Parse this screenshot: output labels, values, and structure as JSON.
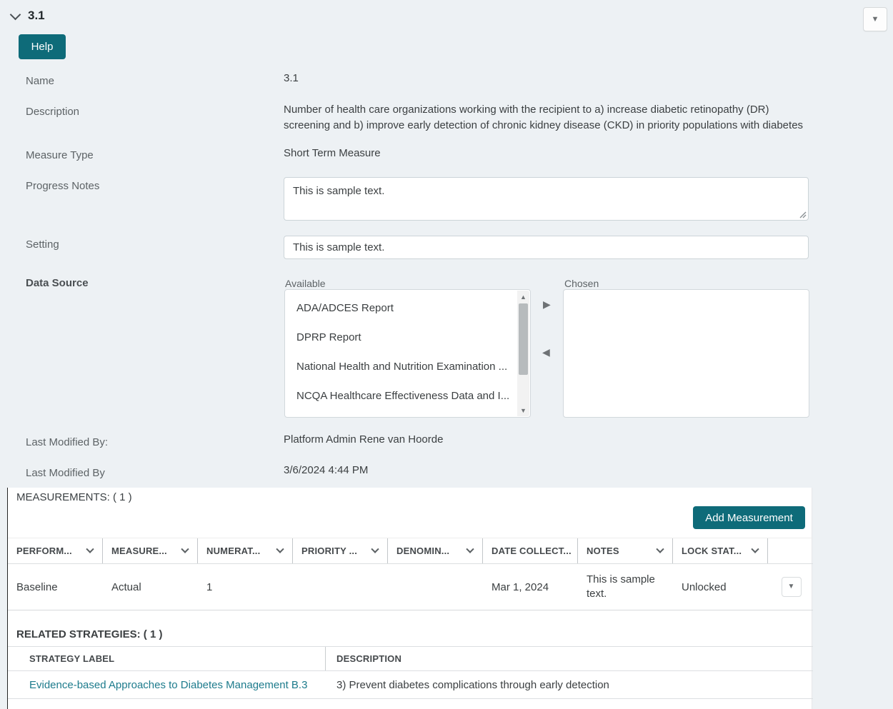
{
  "header": {
    "title": "3.1",
    "help_label": "Help"
  },
  "icons": {
    "dropdown_arrow": "▼",
    "move_right": "▶",
    "move_left": "◀",
    "scroll_up": "▲",
    "scroll_down": "▼"
  },
  "fields": {
    "name": {
      "label": "Name",
      "value": "3.1"
    },
    "description": {
      "label": "Description",
      "value": "Number of health care organizations working with the recipient to a) increase diabetic retinopathy (DR) screening and b) improve early detection of chronic kidney disease (CKD) in priority populations with diabetes"
    },
    "measure_type": {
      "label": "Measure Type",
      "value": "Short Term Measure"
    },
    "progress_notes": {
      "label": "Progress Notes",
      "value": "This is sample text."
    },
    "setting": {
      "label": "Setting",
      "value": "This is sample text."
    },
    "data_source": {
      "label": "Data Source",
      "available_label": "Available",
      "chosen_label": "Chosen",
      "available_options": [
        "ADA/ADCES Report",
        "DPRP Report",
        "National Health and Nutrition Examination ...",
        "NCQA Healthcare Effectiveness Data and I..."
      ],
      "chosen_options": []
    },
    "last_modified_by_name": {
      "label": "Last Modified By:",
      "value": "Platform Admin Rene van Hoorde"
    },
    "last_modified_by_date": {
      "label": "Last Modified By",
      "value": "3/6/2024 4:44 PM"
    }
  },
  "measurements": {
    "title": "MEASUREMENTS: ( 1 )",
    "add_button_label": "Add Measurement",
    "columns": [
      "PERFORM...",
      "MEASURE...",
      "NUMERAT...",
      "PRIORITY ...",
      "DENOMIN...",
      "DATE COLLECT...",
      "NOTES",
      "LOCK STAT..."
    ],
    "rows": [
      {
        "performance": "Baseline",
        "measure": "Actual",
        "numerator": "1",
        "priority": "",
        "denominator": "",
        "date_collected": "Mar 1, 2024",
        "notes": "This is sample text.",
        "lock_status": "Unlocked"
      }
    ]
  },
  "related_strategies": {
    "title": "RELATED STRATEGIES: ( 1 )",
    "columns": {
      "label": "STRATEGY LABEL",
      "description": "DESCRIPTION"
    },
    "rows": [
      {
        "strategy_label": "Evidence-based Approaches to Diabetes Management B.3",
        "description": "3) Prevent diabetes complications through early detection"
      }
    ]
  },
  "colors": {
    "accent_teal": "#0e6b79",
    "link_teal": "#1d7b8c",
    "page_bg": "#edf1f4",
    "panel_border": "#242424"
  }
}
